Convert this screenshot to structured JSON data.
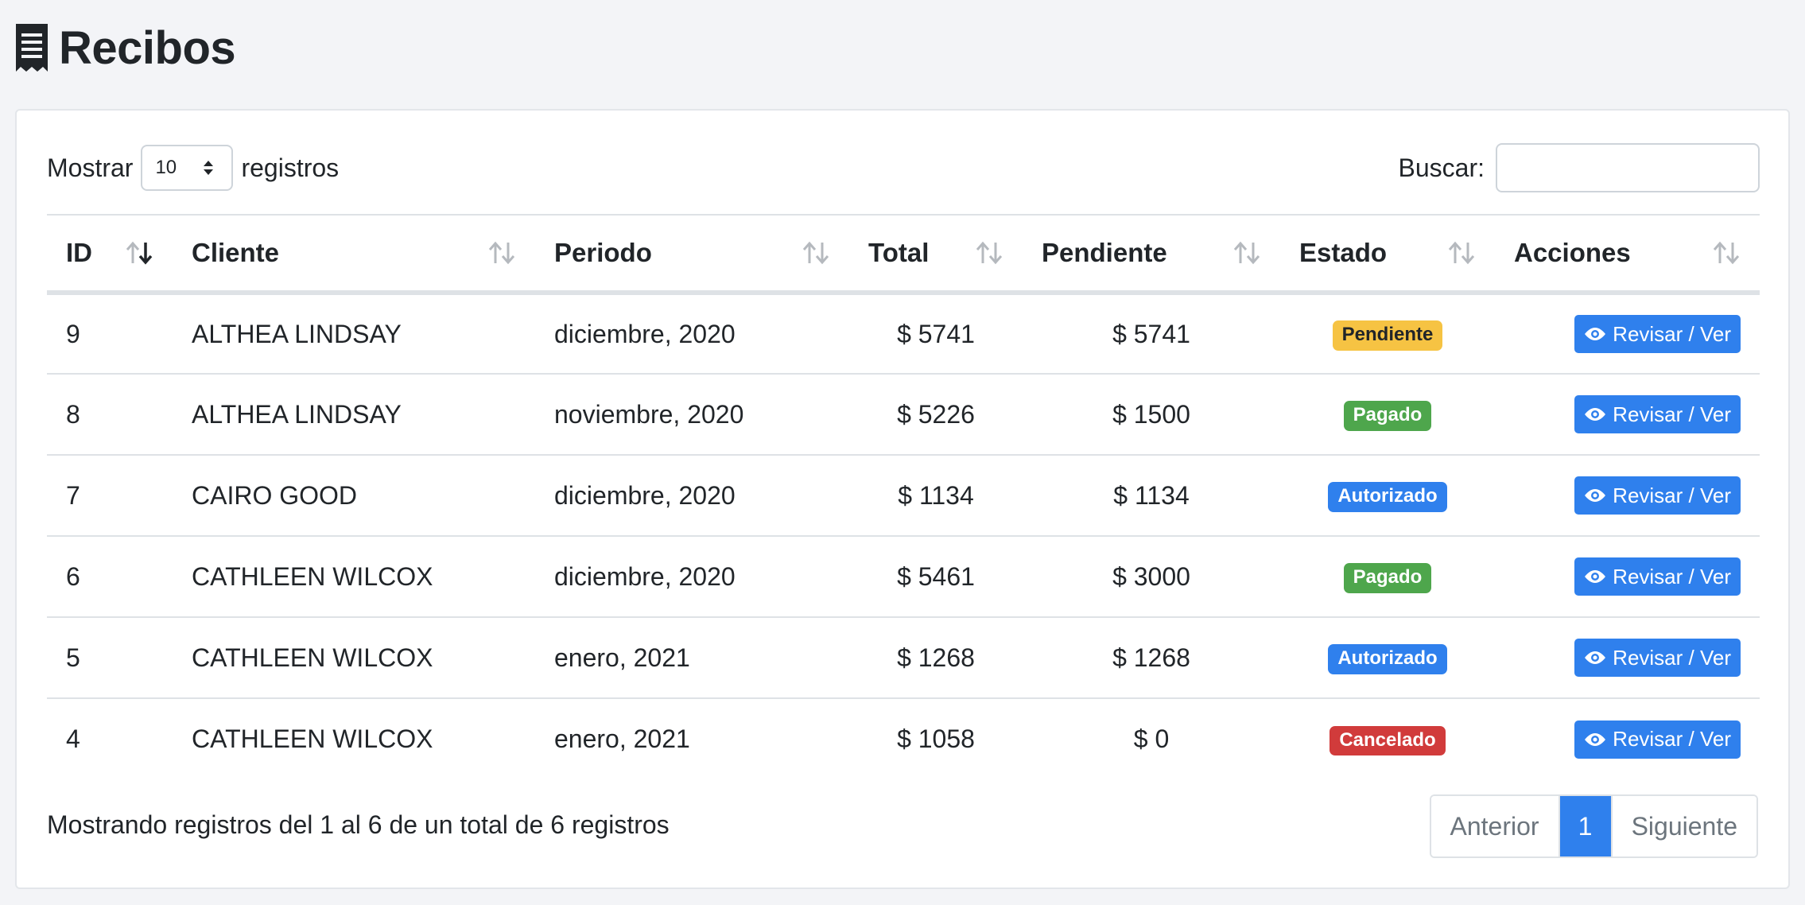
{
  "header": {
    "title": "Recibos",
    "icon": "receipt-icon"
  },
  "controls": {
    "show_prefix": "Mostrar",
    "page_length": "10",
    "show_suffix": "registros",
    "search_label": "Buscar:",
    "search_value": ""
  },
  "table": {
    "columns": [
      "ID",
      "Cliente",
      "Periodo",
      "Total",
      "Pendiente",
      "Estado",
      "Acciones"
    ],
    "sorted_column": "ID",
    "sort_direction": "descending",
    "rows": [
      {
        "id": "9",
        "cliente": "ALTHEA LINDSAY",
        "periodo": "diciembre, 2020",
        "total": "$ 5741",
        "pendiente": "$ 5741",
        "estado": "Pendiente",
        "estado_tone": "warning",
        "accion": "Revisar / Ver"
      },
      {
        "id": "8",
        "cliente": "ALTHEA LINDSAY",
        "periodo": "noviembre, 2020",
        "total": "$ 5226",
        "pendiente": "$ 1500",
        "estado": "Pagado",
        "estado_tone": "success",
        "accion": "Revisar / Ver"
      },
      {
        "id": "7",
        "cliente": "CAIRO GOOD",
        "periodo": "diciembre, 2020",
        "total": "$ 1134",
        "pendiente": "$ 1134",
        "estado": "Autorizado",
        "estado_tone": "primary",
        "accion": "Revisar / Ver"
      },
      {
        "id": "6",
        "cliente": "CATHLEEN WILCOX",
        "periodo": "diciembre, 2020",
        "total": "$ 5461",
        "pendiente": "$ 3000",
        "estado": "Pagado",
        "estado_tone": "success",
        "accion": "Revisar / Ver"
      },
      {
        "id": "5",
        "cliente": "CATHLEEN WILCOX",
        "periodo": "enero, 2021",
        "total": "$ 1268",
        "pendiente": "$ 1268",
        "estado": "Autorizado",
        "estado_tone": "primary",
        "accion": "Revisar / Ver"
      },
      {
        "id": "4",
        "cliente": "CATHLEEN WILCOX",
        "periodo": "enero, 2021",
        "total": "$ 1058",
        "pendiente": "$ 0",
        "estado": "Cancelado",
        "estado_tone": "danger",
        "accion": "Revisar / Ver"
      }
    ]
  },
  "footer": {
    "info": "Mostrando registros del 1 al 6 de un total de 6 registros",
    "prev_label": "Anterior",
    "current_page": "1",
    "next_label": "Siguiente"
  },
  "colors": {
    "primary": "#2f80ed",
    "success": "#4ea64c",
    "warning": "#f6c343",
    "danger": "#d13b3b",
    "background": "#f3f4f7"
  }
}
